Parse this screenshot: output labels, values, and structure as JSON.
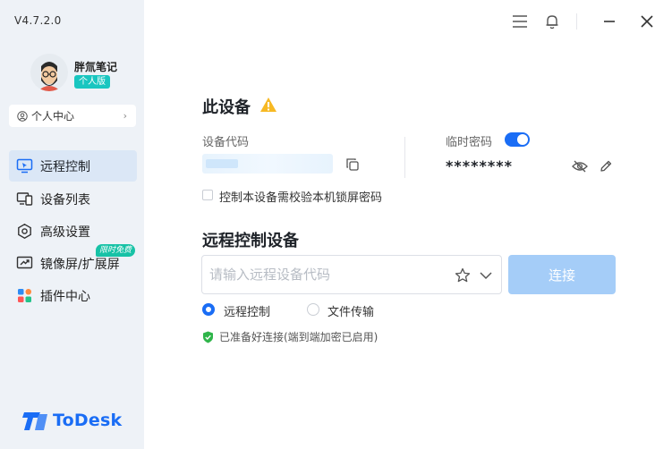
{
  "app": {
    "version": "V4.7.2.0",
    "logo_text": "ToDesk",
    "brand_color": "#1a6df5"
  },
  "user": {
    "name": "胖氚笔记",
    "edition": "个人版",
    "personal_center": "个人中心"
  },
  "sidebar": {
    "items": [
      {
        "label": "远程控制",
        "icon": "remote-control-icon",
        "active": true
      },
      {
        "label": "设备列表",
        "icon": "device-list-icon",
        "active": false
      },
      {
        "label": "高级设置",
        "icon": "settings-icon",
        "active": false
      },
      {
        "label": "镜像屏/扩展屏",
        "icon": "mirror-screen-icon",
        "active": false
      },
      {
        "label": "插件中心",
        "icon": "plugin-center-icon",
        "active": false
      }
    ],
    "promo_badge": "限时免费"
  },
  "titlebar": {
    "icons": [
      "menu-icon",
      "bell-icon",
      "minimize-icon",
      "close-icon"
    ]
  },
  "this_device": {
    "title": "此设备",
    "device_code_label": "设备代码",
    "temp_password_label": "临时密码",
    "temp_password_enabled": true,
    "password_value": "********",
    "lock_screen_check_label": "控制本设备需校验本机锁屏密码",
    "lock_screen_checked": false
  },
  "remote": {
    "title": "远程控制设备",
    "input_placeholder": "请输入远程设备代码",
    "input_value": "",
    "connect_label": "连接",
    "modes": [
      {
        "label": "远程控制",
        "selected": true
      },
      {
        "label": "文件传输",
        "selected": false
      }
    ],
    "status_text": "已准备好连接(端到端加密已启用)",
    "status_color": "#2fb54a"
  }
}
